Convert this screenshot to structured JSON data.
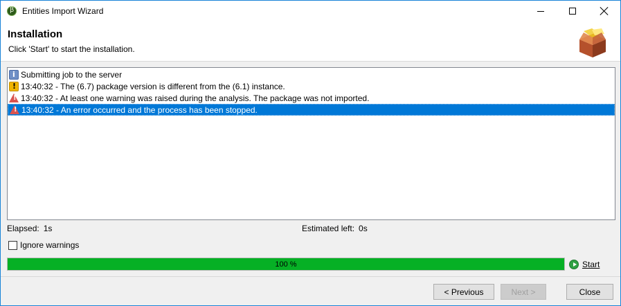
{
  "window": {
    "title": "Entities Import Wizard",
    "minimize": "minimize",
    "maximize": "maximize",
    "close": "close"
  },
  "header": {
    "title": "Installation",
    "subtitle": "Click 'Start' to start the installation."
  },
  "log": {
    "entries": [
      {
        "icon": "info-icon",
        "text": "Submitting job to the server"
      },
      {
        "icon": "warning-icon",
        "text": "13:40:32 - The (6.7) package version is different from the (6.1) instance."
      },
      {
        "icon": "error-icon",
        "text": "13:40:32 - At least one warning was raised during the analysis. The package was not imported."
      },
      {
        "icon": "error-icon",
        "text": "13:40:32 - An error occurred and the process has been stopped.",
        "selected": true
      }
    ]
  },
  "stats": {
    "elapsed_label": "Elapsed:",
    "elapsed_value": "1s",
    "estimated_label": "Estimated left:",
    "estimated_value": "0s"
  },
  "options": {
    "ignore_warnings_label": "Ignore warnings",
    "ignore_warnings_checked": false
  },
  "progress": {
    "value": 100,
    "text": "100 %",
    "color": "#06b025"
  },
  "start": {
    "label": "Start",
    "icon": "play-circle-icon"
  },
  "buttons": {
    "previous": "< Previous",
    "next": "Next >",
    "close": "Close"
  },
  "colors": {
    "selection": "#0078d7",
    "window_border": "#1883d7"
  }
}
